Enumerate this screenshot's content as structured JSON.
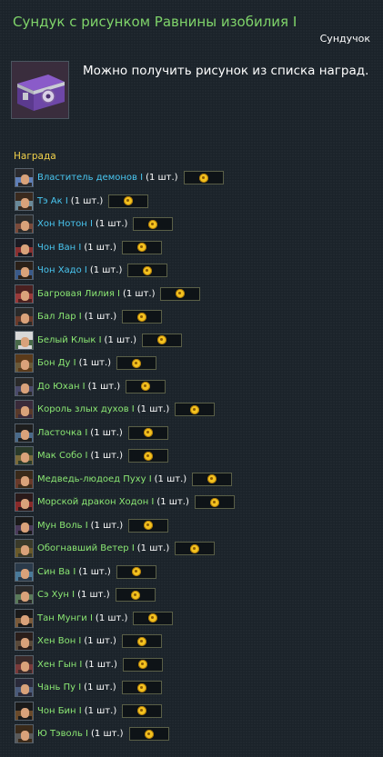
{
  "header": {
    "title": "Сундук с рисунком Равнины изобилия I",
    "category": "Сундучок"
  },
  "item": {
    "icon": "purple-chest-icon",
    "description": "Можно получить рисунок из списка наград."
  },
  "rewards": {
    "label": "Награда",
    "token_icon": "gold-coin-icon",
    "items": [
      {
        "name": "Властитель демонов I",
        "qty": "(1 шт.)",
        "color": "#49c6f0"
      },
      {
        "name": "Тэ Ак I",
        "qty": "(1 шт.)",
        "color": "#49c6f0"
      },
      {
        "name": "Хон Нотон I",
        "qty": "(1 шт.)",
        "color": "#49c6f0"
      },
      {
        "name": "Чон Ван I",
        "qty": "(1 шт.)",
        "color": "#49c6f0"
      },
      {
        "name": "Чон Хадо I",
        "qty": "(1 шт.)",
        "color": "#49c6f0"
      },
      {
        "name": "Багровая Лилия I",
        "qty": "(1 шт.)",
        "color": "#8be873"
      },
      {
        "name": "Бал Лар I",
        "qty": "(1 шт.)",
        "color": "#8be873"
      },
      {
        "name": "Белый Клык I",
        "qty": "(1 шт.)",
        "color": "#8be873"
      },
      {
        "name": "Бон Ду I",
        "qty": "(1 шт.)",
        "color": "#8be873"
      },
      {
        "name": "До Юхан I",
        "qty": "(1 шт.)",
        "color": "#8be873"
      },
      {
        "name": "Король злых духов I",
        "qty": "(1 шт.)",
        "color": "#8be873"
      },
      {
        "name": "Ласточка I",
        "qty": "(1 шт.)",
        "color": "#8be873"
      },
      {
        "name": "Мак Собо I",
        "qty": "(1 шт.)",
        "color": "#8be873"
      },
      {
        "name": "Медведь-людоед Пуху I",
        "qty": "(1 шт.)",
        "color": "#8be873"
      },
      {
        "name": "Морской дракон Ходон I",
        "qty": "(1 шт.)",
        "color": "#8be873"
      },
      {
        "name": "Мун Воль I",
        "qty": "(1 шт.)",
        "color": "#8be873"
      },
      {
        "name": "Обогнавший Ветер I",
        "qty": "(1 шт.)",
        "color": "#8be873"
      },
      {
        "name": "Син Ва I",
        "qty": "(1 шт.)",
        "color": "#8be873"
      },
      {
        "name": "Сэ Хун I",
        "qty": "(1 шт.)",
        "color": "#8be873"
      },
      {
        "name": "Тан Мунги I",
        "qty": "(1 шт.)",
        "color": "#8be873"
      },
      {
        "name": "Хен Вон I",
        "qty": "(1 шт.)",
        "color": "#8be873"
      },
      {
        "name": "Хен Гын I",
        "qty": "(1 шт.)",
        "color": "#8be873"
      },
      {
        "name": "Чань Пу I",
        "qty": "(1 шт.)",
        "color": "#8be873"
      },
      {
        "name": "Чон Бин I",
        "qty": "(1 шт.)",
        "color": "#8be873"
      },
      {
        "name": "Ю Тэволь I",
        "qty": "(1 шт.)",
        "color": "#8be873"
      }
    ]
  }
}
